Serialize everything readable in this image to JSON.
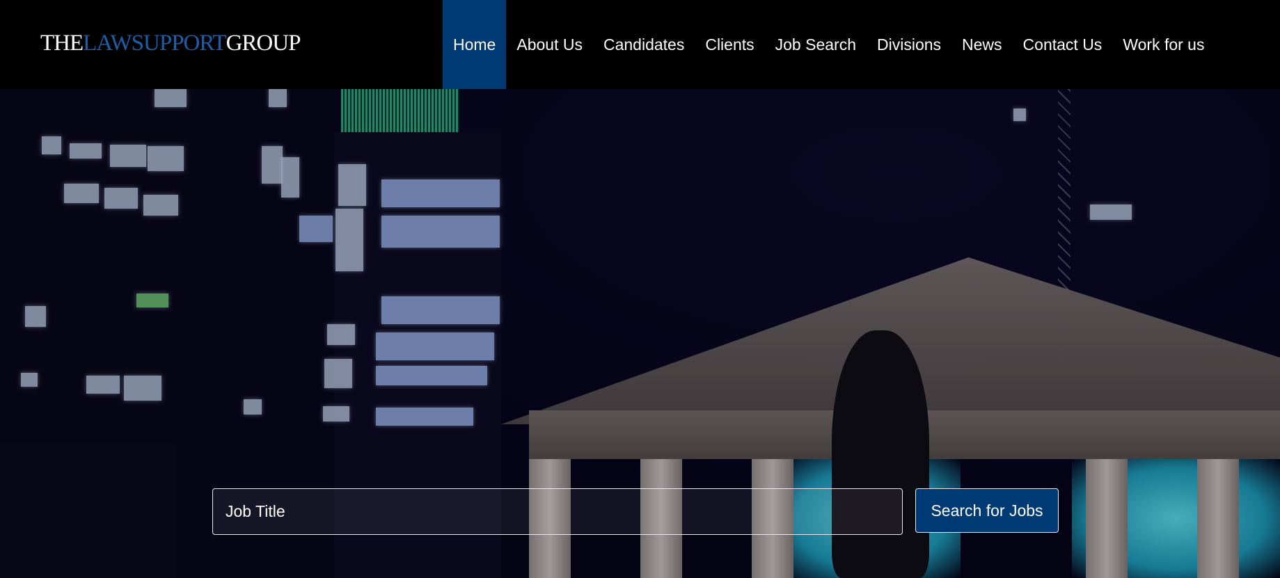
{
  "header": {
    "logo": {
      "part1": "THE",
      "part2": "LAWSUPPORT",
      "part3": "GROUP"
    },
    "nav": [
      {
        "label": "Home",
        "active": true
      },
      {
        "label": "About Us"
      },
      {
        "label": "Candidates"
      },
      {
        "label": "Clients"
      },
      {
        "label": "Job Search"
      },
      {
        "label": "Divisions"
      },
      {
        "label": "News"
      },
      {
        "label": "Contact Us"
      },
      {
        "label": "Work for us"
      }
    ]
  },
  "search": {
    "placeholder": "Job Title",
    "button_label": "Search for Jobs"
  },
  "colors": {
    "brand_blue": "#003a74",
    "logo_accent": "#1c5ea8",
    "header_bg": "#000000"
  }
}
